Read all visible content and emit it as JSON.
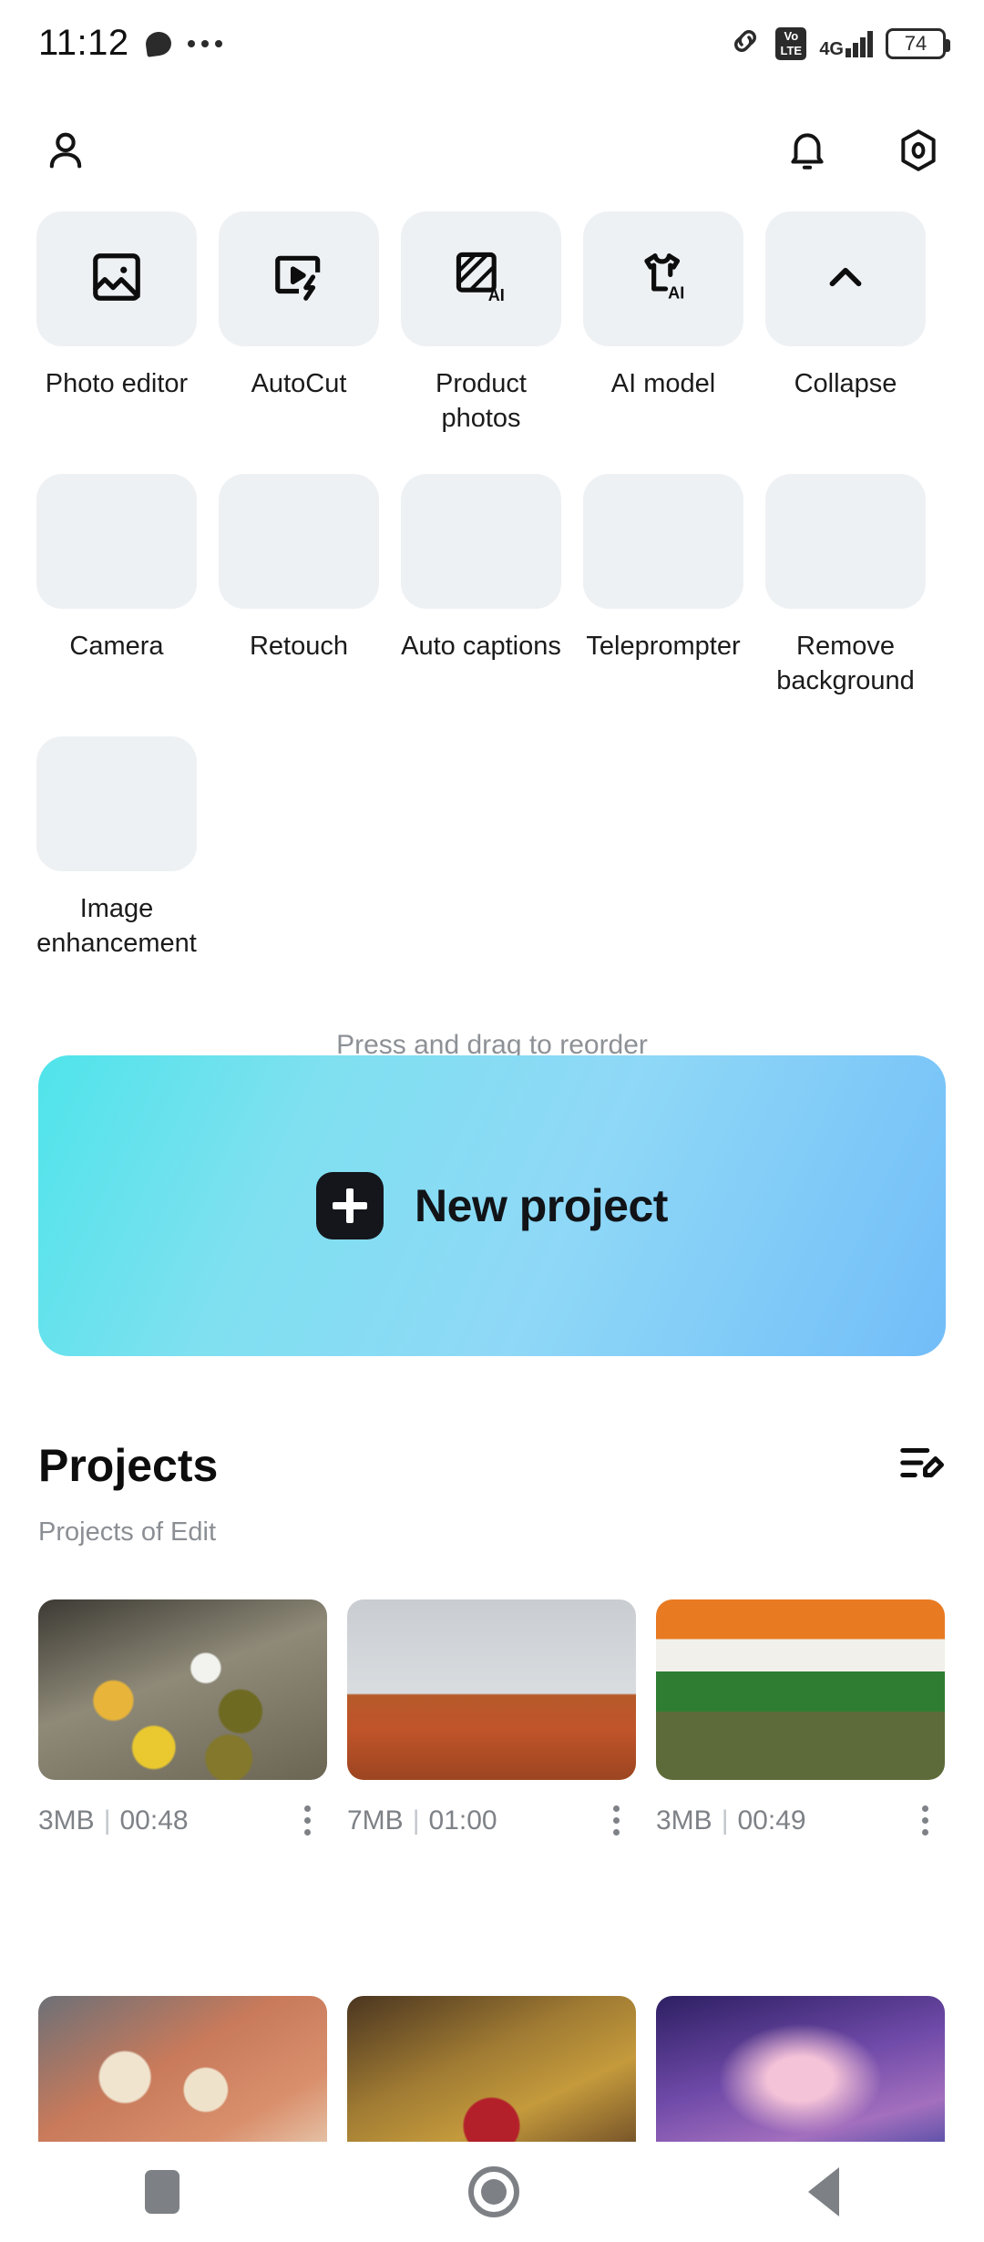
{
  "status_bar": {
    "time": "11:12",
    "chat_icon": "chat-bubble-icon",
    "overflow_icon": "more-dots-icon",
    "link_icon": "link-icon",
    "volte_top": "Vo",
    "volte_bottom": "LTE",
    "network": "4G",
    "battery": "74"
  },
  "app_bar": {
    "profile_icon": "person-icon",
    "notification_icon": "bell-icon",
    "settings_icon": "hexagon-settings-icon"
  },
  "tools": {
    "hint": "Press and drag to reorder",
    "rows": [
      [
        {
          "label": "Photo editor",
          "icon": "image-edit-icon",
          "has_icon": true
        },
        {
          "label": "AutoCut",
          "icon": "play-bolt-icon",
          "has_icon": true
        },
        {
          "label": "Product photos",
          "icon": "ai-square-icon",
          "has_icon": true
        },
        {
          "label": "AI model",
          "icon": "tshirt-ai-icon",
          "has_icon": true
        },
        {
          "label": "Collapse",
          "icon": "chevron-up-icon",
          "has_icon": true
        }
      ],
      [
        {
          "label": "Camera",
          "icon": "camera-icon",
          "has_icon": false
        },
        {
          "label": "Retouch",
          "icon": "retouch-icon",
          "has_icon": false
        },
        {
          "label": "Auto captions",
          "icon": "captions-icon",
          "has_icon": false
        },
        {
          "label": "Teleprompter",
          "icon": "teleprompter-icon",
          "has_icon": false
        },
        {
          "label": "Remove background",
          "icon": "remove-background-icon",
          "has_icon": false
        }
      ],
      [
        {
          "label": "Image enhancement",
          "icon": "image-enhance-icon",
          "has_icon": false
        }
      ]
    ]
  },
  "new_project": {
    "label": "New project",
    "plus_icon": "plus-icon",
    "gradient_from": "#4fe4ea",
    "gradient_to": "#72bdf8"
  },
  "projects": {
    "title": "Projects",
    "subtitle": "Projects of Edit",
    "edit_icon": "list-edit-icon",
    "menu_icon": "kebab-menu-icon",
    "row1": [
      {
        "size": "3MB",
        "separator": "|",
        "duration": "00:48",
        "thumb": "indian-thali-food"
      },
      {
        "size": "7MB",
        "separator": "|",
        "duration": "01:00",
        "thumb": "crowd-crane-flag"
      },
      {
        "size": "3MB",
        "separator": "|",
        "duration": "00:49",
        "thumb": "soldier-indian-flag"
      }
    ],
    "row2": [
      {
        "thumb": "clay-cups-lassi"
      },
      {
        "thumb": "temple-deity"
      },
      {
        "thumb": "dolphins-heart"
      }
    ]
  },
  "navigation": {
    "recents_icon": "square-recents-icon",
    "home_icon": "circle-home-icon",
    "back_icon": "triangle-back-icon"
  }
}
